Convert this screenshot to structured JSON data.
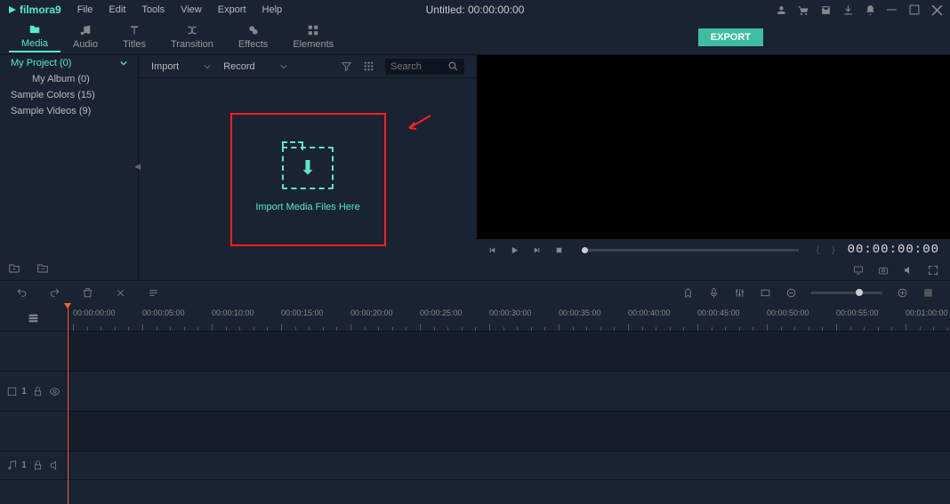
{
  "app": {
    "name": "filmora9"
  },
  "menu": [
    "File",
    "Edit",
    "Tools",
    "View",
    "Export",
    "Help"
  ],
  "title": "Untitled:  00:00:00:00",
  "tabs": [
    {
      "label": "Media",
      "id": "media"
    },
    {
      "label": "Audio",
      "id": "audio"
    },
    {
      "label": "Titles",
      "id": "titles"
    },
    {
      "label": "Transition",
      "id": "transition"
    },
    {
      "label": "Effects",
      "id": "effects"
    },
    {
      "label": "Elements",
      "id": "elements"
    }
  ],
  "export_label": "EXPORT",
  "sidebar": {
    "project": "My Project (0)",
    "album": "My Album (0)",
    "colors": "Sample Colors (15)",
    "videos": "Sample Videos (9)"
  },
  "media_toolbar": {
    "import": "Import",
    "record": "Record",
    "search_placeholder": "Search"
  },
  "import_drop": "Import Media Files Here",
  "preview": {
    "time": "00:00:00:00"
  },
  "timeline": {
    "labels": [
      "00:00:00:00",
      "00:00:05:00",
      "00:00:10:00",
      "00:00:15:00",
      "00:00:20:00",
      "00:00:25:00",
      "00:00:30:00",
      "00:00:35:00",
      "00:00:40:00",
      "00:00:45:00",
      "00:00:50:00",
      "00:00:55:00",
      "00:01:00:00"
    ],
    "video_track": "1",
    "audio_track": "1"
  }
}
